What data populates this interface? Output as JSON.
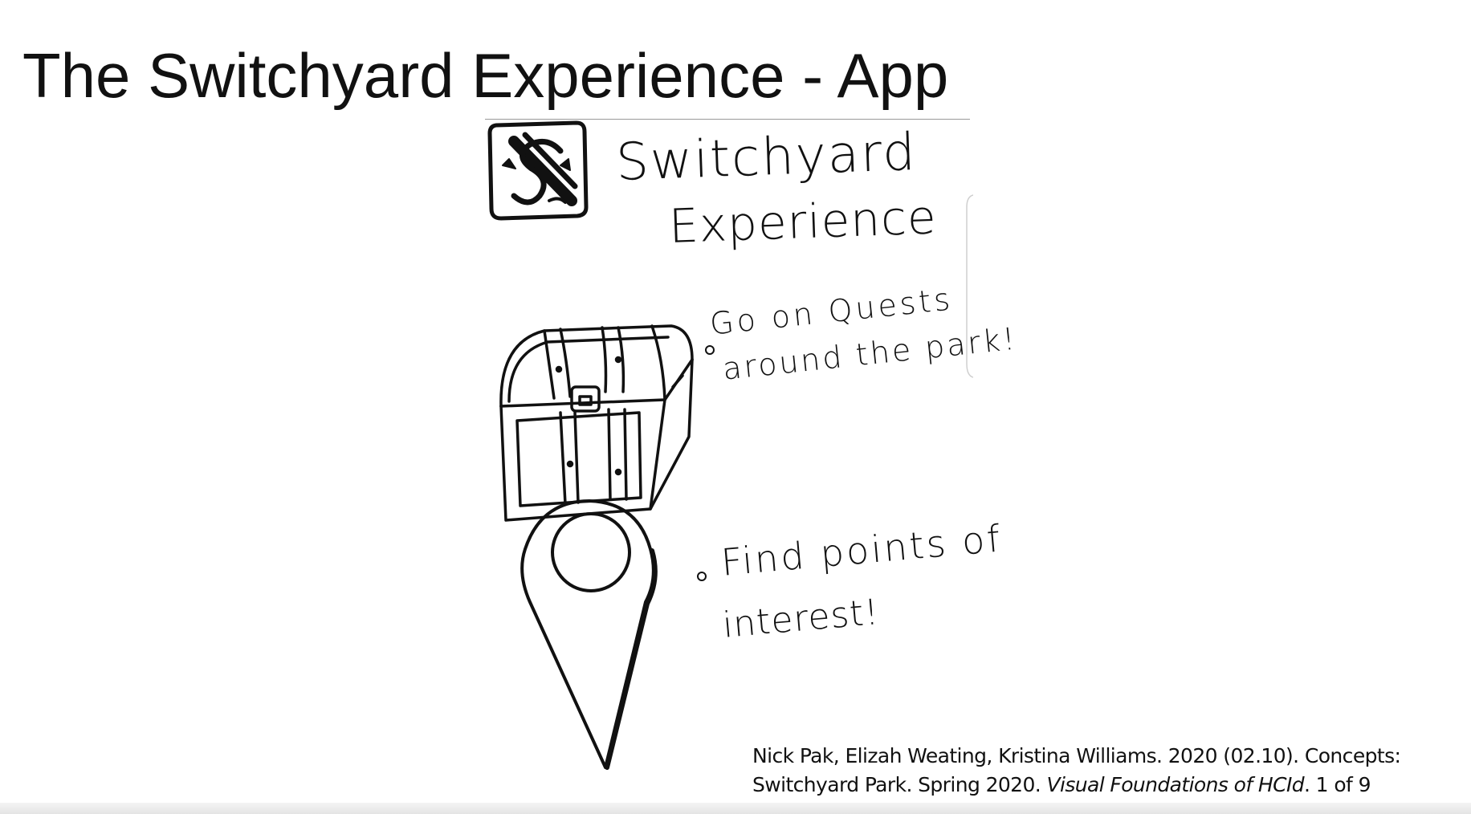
{
  "slide": {
    "title": "The Switchyard Experience - App"
  },
  "sketch": {
    "app_name_line1": "Switchyard",
    "app_name_line2": "Experience",
    "icons": [
      "switchyard-logo-icon",
      "treasure-chest-icon",
      "map-pin-icon"
    ],
    "bullets": [
      {
        "line1": "Go  on  Quests",
        "line2": "around  the  park!"
      },
      {
        "line1": "Find  points  of",
        "line2": "interest!"
      }
    ]
  },
  "citation": {
    "line1": "Nick Pak, Elizah Weating, Kristina Williams. 2020 (02.10). Concepts:",
    "line2_plain": "Switchyard Park. Spring 2020. ",
    "line2_italic": "Visual Foundations of HCId",
    "line2_tail": ". 1 of 9"
  }
}
